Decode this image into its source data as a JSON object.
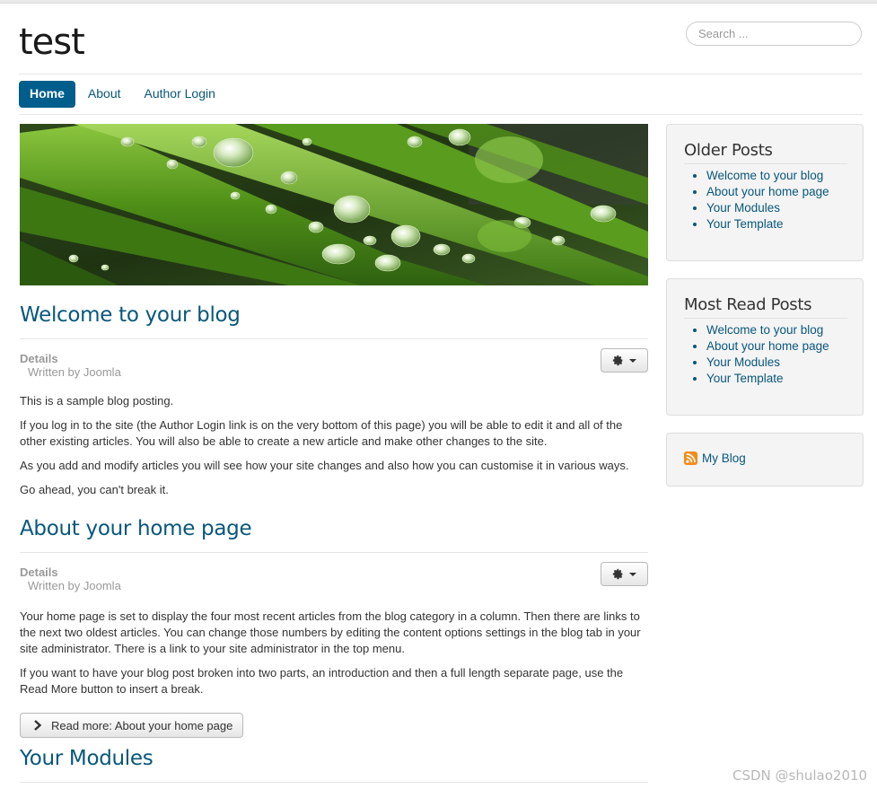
{
  "site": {
    "title": "test",
    "search_placeholder": "Search ..."
  },
  "nav": {
    "items": [
      {
        "label": "Home",
        "active": true
      },
      {
        "label": "About",
        "active": false
      },
      {
        "label": "Author Login",
        "active": false
      }
    ]
  },
  "articles": [
    {
      "title": "Welcome to your blog",
      "details_label": "Details",
      "written_by": "Written by Joomla",
      "paragraphs": [
        "This is a sample blog posting.",
        "If you log in to the site (the Author Login link is on the very bottom of this page) you will be able to edit it and all of the other existing articles. You will also be able to create a new article and make other changes to the site.",
        "As you add and modify articles you will see how your site changes and also how you can customise it in various ways.",
        "Go ahead, you can't break it."
      ]
    },
    {
      "title": "About your home page",
      "details_label": "Details",
      "written_by": "Written by Joomla",
      "paragraphs": [
        "Your home page is set to display the four most recent articles from the blog category in a column. Then there are links to the next two oldest articles. You can change those numbers by editing the content options settings in the blog tab in your site administrator. There is a link to your site administrator in the top menu.",
        "If you want to have your blog post broken into two parts, an introduction and then a full length separate page, use the Read More button to insert a break."
      ],
      "readmore_label": "Read more: About your home page"
    },
    {
      "title": "Your Modules"
    }
  ],
  "sidebar": {
    "older_posts": {
      "title": "Older Posts",
      "items": [
        "Welcome to your blog",
        "About your home page",
        "Your Modules",
        "Your Template"
      ]
    },
    "most_read": {
      "title": "Most Read Posts",
      "items": [
        "Welcome to your blog",
        "About your home page",
        "Your Modules",
        "Your Template"
      ]
    },
    "feed": {
      "label": "My Blog",
      "icon": "rss-icon"
    }
  },
  "watermark": "CSDN @shulao2010",
  "colors": {
    "link": "#08577c",
    "nav_active_bg": "#005e8d",
    "muted": "#999999",
    "banner_green": "#4a8a12"
  },
  "icons": {
    "article_tools": "gear-icon",
    "readmore": "chevron-right-icon"
  }
}
